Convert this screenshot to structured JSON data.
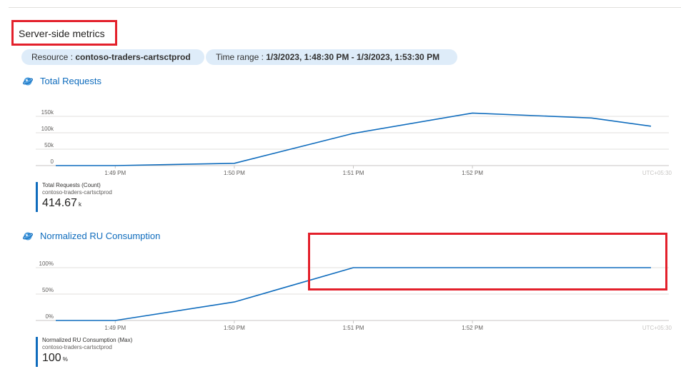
{
  "section": {
    "title": "Server-side metrics"
  },
  "filters": {
    "resource_label": "Resource : ",
    "resource_value": "contoso-traders-cartsctprod",
    "time_label": "Time range : ",
    "time_value": "1/3/2023, 1:48:30 PM - 1/3/2023, 1:53:30 PM"
  },
  "charts": [
    {
      "title": "Total Requests",
      "icon": "cosmos-db-icon",
      "legend_metric": "Total Requests (Count)",
      "legend_resource": "contoso-traders-cartsctprod",
      "summary_value": "414.67",
      "summary_unit": "k",
      "timezone": "UTC+05:30"
    },
    {
      "title": "Normalized RU Consumption",
      "icon": "cosmos-db-icon",
      "legend_metric": "Normalized RU Consumption (Max)",
      "legend_resource": "contoso-traders-cartsctprod",
      "summary_value": "100",
      "summary_unit": "%",
      "timezone": "UTC+05:30"
    }
  ],
  "chart_data": [
    {
      "type": "line",
      "title": "Total Requests",
      "x_ticks": [
        "1:49 PM",
        "1:50 PM",
        "1:51 PM",
        "1:52 PM"
      ],
      "y_ticks": [
        "150k",
        "100k",
        "50k",
        "0"
      ],
      "ylim": [
        0,
        150000
      ],
      "grid": true,
      "series": [
        {
          "name": "Total Requests (Count)",
          "color": "#0f6cbd",
          "x": [
            "1:48:30 PM",
            "1:49 PM",
            "1:50 PM",
            "1:51 PM",
            "1:52 PM",
            "1:53 PM",
            "1:53:30 PM"
          ],
          "values": [
            0,
            0,
            7000,
            98000,
            160000,
            145000,
            120000
          ]
        }
      ]
    },
    {
      "type": "line",
      "title": "Normalized RU Consumption",
      "x_ticks": [
        "1:49 PM",
        "1:50 PM",
        "1:51 PM",
        "1:52 PM"
      ],
      "y_ticks": [
        "100%",
        "50%",
        "0%"
      ],
      "ylim": [
        0,
        100
      ],
      "grid": true,
      "series": [
        {
          "name": "Normalized RU Consumption (Max)",
          "color": "#0f6cbd",
          "x": [
            "1:48:30 PM",
            "1:49 PM",
            "1:50 PM",
            "1:51 PM",
            "1:52 PM",
            "1:53 PM",
            "1:53:30 PM"
          ],
          "values": [
            0,
            0,
            35,
            100,
            100,
            100,
            100
          ]
        }
      ]
    }
  ]
}
